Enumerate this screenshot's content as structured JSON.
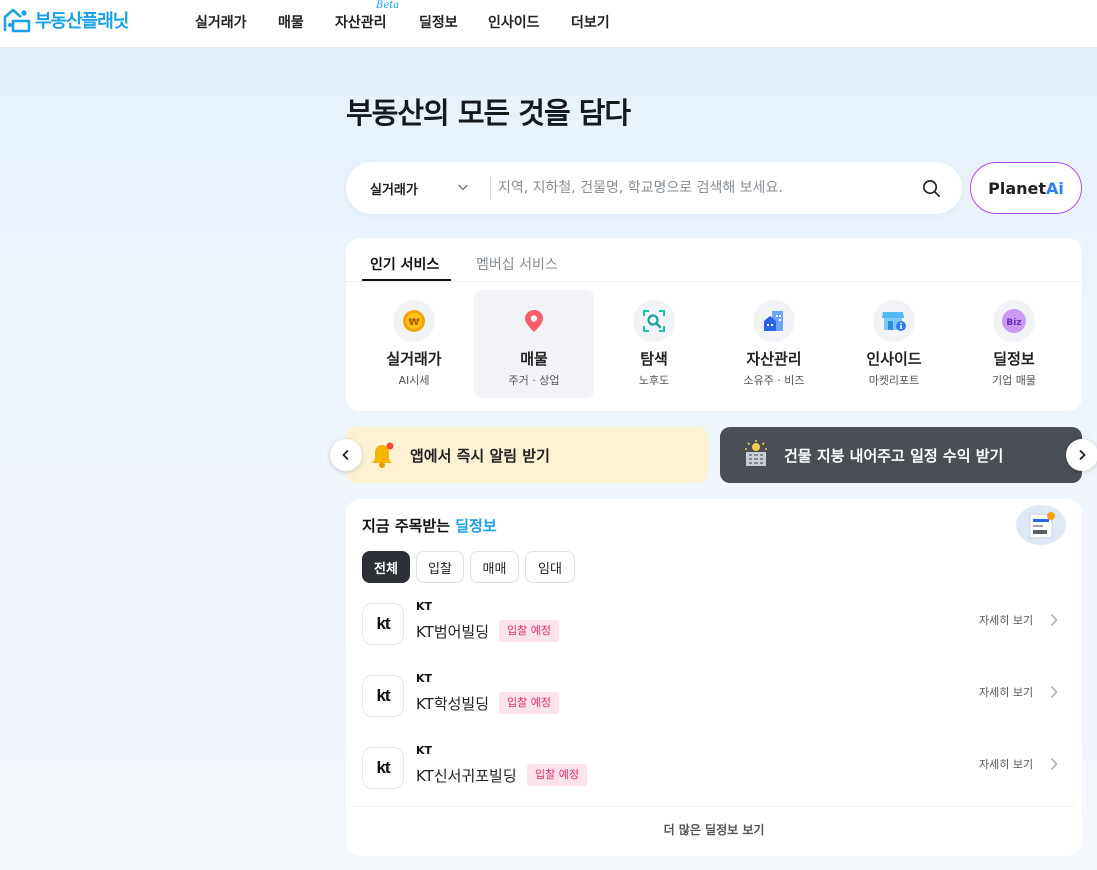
{
  "header": {
    "logo_text": "부동산플래닛",
    "nav": [
      "실거래가",
      "매물",
      "자산관리",
      "딜정보",
      "인사이드",
      "더보기"
    ],
    "beta_badge": "Beta"
  },
  "hero": {
    "title": "부동산의 모든 것을 담다",
    "search_type": "실거래가",
    "search_placeholder": "지역, 지하철, 건물명, 학교명으로 검색해 보세요.",
    "planet_ai": {
      "text": "Planet",
      "accent": "Ai"
    }
  },
  "services": {
    "tabs": [
      "인기 서비스",
      "멤버십 서비스"
    ],
    "items": [
      {
        "label": "실거래가",
        "sub": "AI시세",
        "icon": "won-coin-icon"
      },
      {
        "label": "매물",
        "sub": "주거 · 상업",
        "icon": "map-pin-icon"
      },
      {
        "label": "탐색",
        "sub": "노후도",
        "icon": "scan-search-icon"
      },
      {
        "label": "자산관리",
        "sub": "소유주 · 비즈",
        "icon": "building-icon"
      },
      {
        "label": "인사이드",
        "sub": "마켓리포트",
        "icon": "store-info-icon"
      },
      {
        "label": "딜정보",
        "sub": "기업 매물",
        "icon": "biz-icon",
        "icon_text": "Biz"
      }
    ]
  },
  "banners": {
    "left": "앱에서 즉시 알림 받기",
    "right": "건물 지붕 내어주고 일정 수익 받기"
  },
  "deals": {
    "title_prefix": "지금 주목받는 ",
    "title_highlight": "딜정보",
    "filters": [
      "전체",
      "입찰",
      "매매",
      "임대"
    ],
    "items": [
      {
        "company": "KT",
        "name": "KT범어빌딩",
        "badge": "입찰 예정",
        "more": "자세히 보기"
      },
      {
        "company": "KT",
        "name": "KT학성빌딩",
        "badge": "입찰 예정",
        "more": "자세히 보기"
      },
      {
        "company": "KT",
        "name": "KT신서귀포빌딩",
        "badge": "입찰 예정",
        "more": "자세히 보기"
      }
    ],
    "footer": "더 많은 딜정보 보기",
    "logo_text": "kt"
  },
  "colors": {
    "brand": "#1aa0e6",
    "ai_border": "#b04be0",
    "badge_text": "#e0306a",
    "badge_bg": "#fde4ec",
    "dark_banner": "#4a4e55",
    "light_banner": "#fdf3d3"
  }
}
